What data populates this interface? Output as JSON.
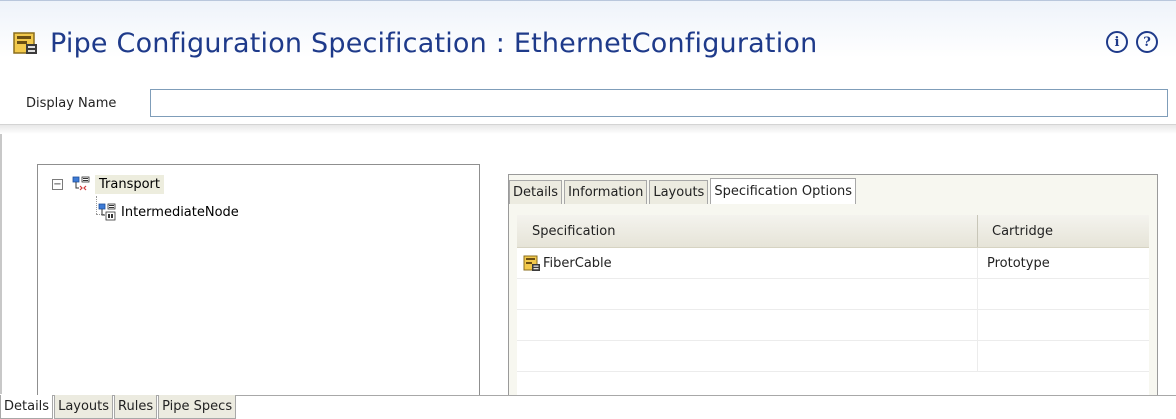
{
  "header": {
    "title": "Pipe Configuration Specification : EthernetConfiguration",
    "title_icon": "specification-editor-icon",
    "info_icon_glyph": "i",
    "help_icon_glyph": "?"
  },
  "display_name": {
    "label": "Display Name",
    "value": "",
    "placeholder": ""
  },
  "tree": {
    "nodes": [
      {
        "label": "Transport",
        "expander": "−",
        "icon": "pipe-tree-icon",
        "selected": true
      },
      {
        "label": "IntermediateNode",
        "icon": "node-tree-icon",
        "selected": false
      }
    ]
  },
  "inner_tabs": [
    {
      "label": "Details",
      "active": false
    },
    {
      "label": "Information",
      "active": false
    },
    {
      "label": "Layouts",
      "active": false
    },
    {
      "label": "Specification Options",
      "active": true
    }
  ],
  "table": {
    "columns": [
      "Specification",
      "Cartridge"
    ],
    "rows": [
      {
        "specification": "FiberCable",
        "cartridge": "Prototype",
        "icon": "specification-icon"
      }
    ]
  },
  "bottom_tabs": [
    {
      "label": "Details",
      "active": true
    },
    {
      "label": "Layouts",
      "active": false
    },
    {
      "label": "Rules",
      "active": false
    },
    {
      "label": "Pipe Specs",
      "active": false
    }
  ],
  "colors": {
    "title": "#1e3a8a",
    "tab_background": "#ecebe0",
    "selected_node": "#ededde"
  }
}
